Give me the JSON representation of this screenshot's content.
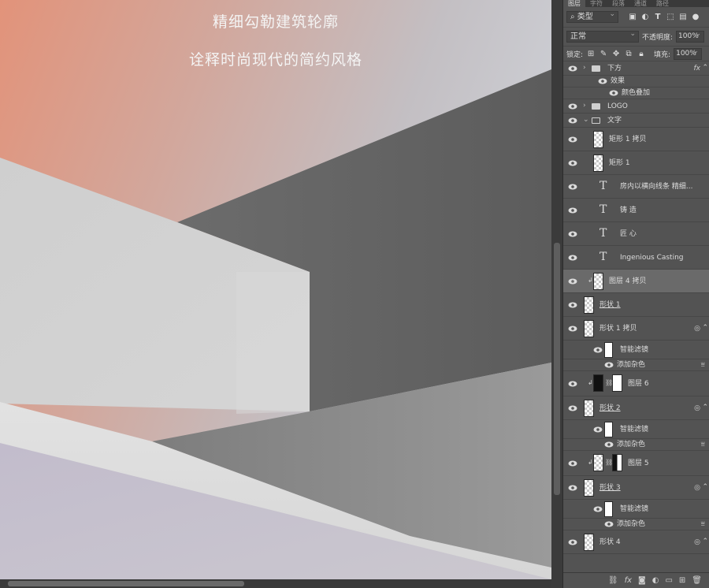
{
  "canvas": {
    "title_line1": "精细勾勒建筑轮廓",
    "title_line2": "诠释时尚现代的简约风格"
  },
  "panel": {
    "tabs": [
      "图层",
      "字符",
      "段落",
      "通道",
      "路径"
    ],
    "filter": {
      "kind_label": "类型",
      "search_icon": "search-icon"
    },
    "blend_mode": "正常",
    "opacity_label": "不透明度:",
    "opacity_value": "100%",
    "lock_label": "锁定:",
    "fill_label": "填充:",
    "fill_value": "100%",
    "layers": [
      {
        "name": "下方",
        "type": "group",
        "fx": "fx"
      },
      {
        "name": "效果",
        "type": "effects"
      },
      {
        "name": "颜色叠加",
        "type": "effect"
      },
      {
        "name": "LOGO",
        "type": "group"
      },
      {
        "name": "文字",
        "type": "group-open"
      },
      {
        "name": "矩形 1 拷贝",
        "type": "shape"
      },
      {
        "name": "矩形 1",
        "type": "shape"
      },
      {
        "name": "房内以横向线条 精细...",
        "type": "text"
      },
      {
        "name": "铸 造",
        "type": "text"
      },
      {
        "name": "匠 心",
        "type": "text"
      },
      {
        "name": "Ingenious Casting",
        "type": "text"
      },
      {
        "name": "图层 4 拷贝",
        "type": "pixel",
        "selected": true
      },
      {
        "name": "形状 1",
        "type": "shape"
      },
      {
        "name": "形状 1 拷贝",
        "type": "smart"
      },
      {
        "name": "智能滤镜",
        "type": "smart-filter"
      },
      {
        "name": "添加杂色",
        "type": "filter"
      },
      {
        "name": "图层 6",
        "type": "masked"
      },
      {
        "name": "形状 2",
        "type": "smart"
      },
      {
        "name": "智能滤镜",
        "type": "smart-filter"
      },
      {
        "name": "添加杂色",
        "type": "filter"
      },
      {
        "name": "图层 5",
        "type": "masked"
      },
      {
        "name": "形状 3",
        "type": "smart"
      },
      {
        "name": "智能滤镜",
        "type": "smart-filter"
      },
      {
        "name": "添加杂色",
        "type": "filter"
      },
      {
        "name": "形状 4",
        "type": "smart"
      }
    ]
  }
}
